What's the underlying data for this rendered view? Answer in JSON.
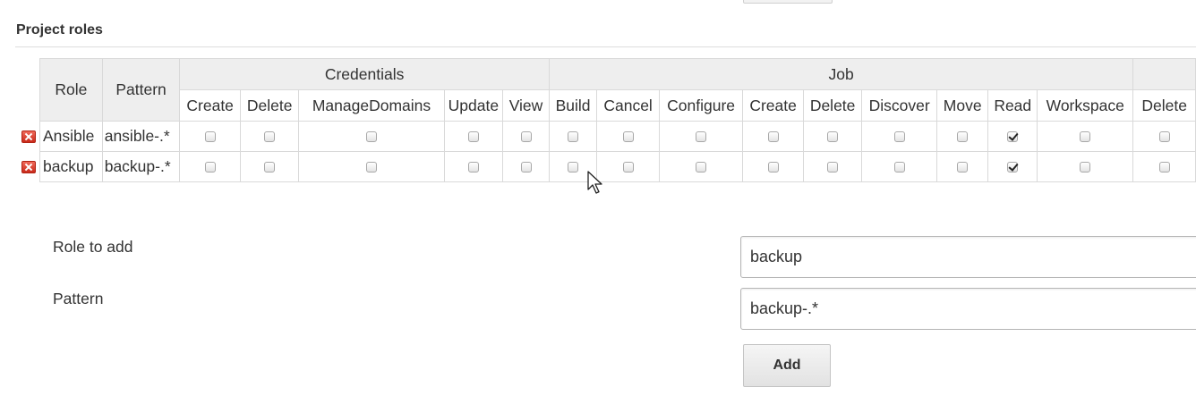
{
  "section": {
    "title": "Project roles"
  },
  "table": {
    "col_role": "Role",
    "col_pattern": "Pattern",
    "groups": [
      {
        "label": "Credentials",
        "span": 5
      },
      {
        "label": "Job",
        "span": 11
      }
    ],
    "permissions": [
      "Create",
      "Delete",
      "ManageDomains",
      "Update",
      "View",
      "Build",
      "Cancel",
      "Configure",
      "Create",
      "Delete",
      "Discover",
      "Move",
      "Read",
      "Workspace",
      "Delete"
    ],
    "rows": [
      {
        "role": "Ansible",
        "pattern": "ansible-.*",
        "checks": [
          false,
          false,
          false,
          false,
          false,
          false,
          false,
          false,
          false,
          false,
          false,
          false,
          true,
          false,
          false
        ]
      },
      {
        "role": "backup",
        "pattern": "backup-.*",
        "checks": [
          false,
          false,
          false,
          false,
          false,
          false,
          false,
          false,
          false,
          false,
          false,
          false,
          true,
          false,
          false
        ]
      }
    ],
    "delete_icon": "delete-icon"
  },
  "form": {
    "role_label": "Role to add",
    "role_value": "backup",
    "pattern_label": "Pattern",
    "pattern_value": "backup-.*",
    "add_label": "Add"
  },
  "cursor_icon": "mouse-pointer-icon"
}
